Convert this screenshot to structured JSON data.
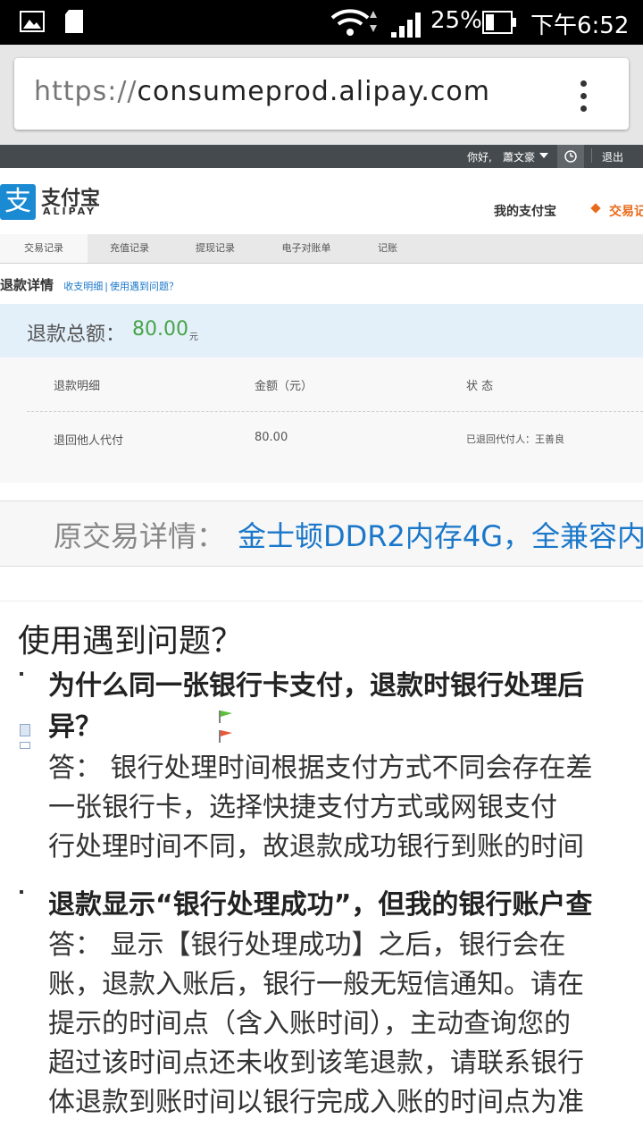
{
  "status_bar": {
    "battery": "25%",
    "time": "下午6:52"
  },
  "browser": {
    "url_scheme": "https://",
    "url_host": "consumeprod.alipay.com"
  },
  "top_nav": {
    "greeting": "你好,",
    "username": "蕭文豪",
    "logout": "退出"
  },
  "brand": {
    "cn": "支付宝",
    "en": "ALIPAY",
    "logo_char": "支"
  },
  "header_nav": {
    "my_alipay": "我的支付宝",
    "trade": "交易记"
  },
  "subnav": [
    "交易记录",
    "充值记录",
    "提现记录",
    "电子对账单",
    "记账"
  ],
  "refund": {
    "title": "退款详情",
    "link_detail": "收支明细",
    "link_sep": "|",
    "link_help": "使用遇到问题？",
    "total_label": "退款总额：",
    "total_value": "80.00",
    "total_unit": "元",
    "columns": [
      "退款明细",
      "金额（元）",
      "状 态"
    ],
    "rows": [
      {
        "detail": "退回他人代付",
        "amount": "80.00",
        "status": "已退回代付人：王善良"
      }
    ]
  },
  "original": {
    "label": "原交易详情：",
    "value": "金士顿DDR2内存4G，全兼容内"
  },
  "faq": {
    "heading": "使用遇到问题？",
    "items": [
      {
        "question": [
          "为什么同一张银行卡支付，退款时银行处理后",
          "异？"
        ],
        "answer": [
          "答： 银行处理时间根据支付方式不同会存在差",
          "一张银行卡，选择快捷支付方式或网银支付",
          "行处理时间不同，故退款成功银行到账的时间"
        ]
      },
      {
        "question": [
          "退款显示“银行处理成功”，但我的银行账户查"
        ],
        "answer": [
          "答： 显示【银行处理成功】之后，银行会在",
          "账，退款入账后，银行一般无短信通知。请在",
          "提示的时间点（含入账时间），主动查询您的",
          "超过该时间点还未收到该笔退款，请联系银行",
          "体退款到账时间以银行完成入账的时间点为准"
        ]
      }
    ]
  },
  "colors": {
    "brand_blue": "#1a8ad2",
    "amount_green": "#47a447",
    "orange": "#e86a1a"
  },
  "icons": [
    "image-icon",
    "sd-card-icon",
    "wifi-icon",
    "signal-icon",
    "battery-icon",
    "overflow-menu-icon",
    "dropdown-caret-icon",
    "alarm-icon",
    "diamond-icon",
    "flag-icon"
  ]
}
